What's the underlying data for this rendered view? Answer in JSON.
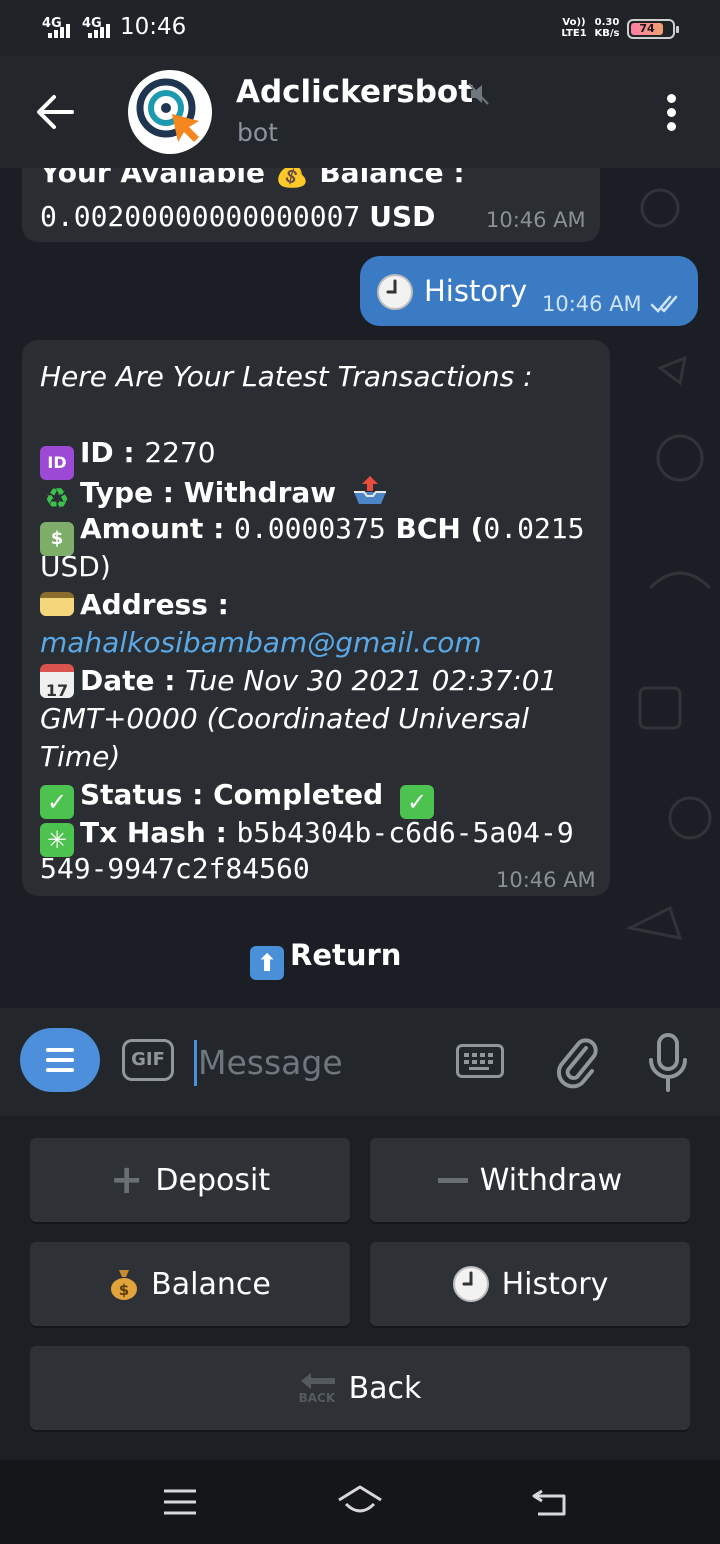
{
  "status_bar": {
    "net1": "4G",
    "net2": "4G",
    "time": "10:46",
    "volte": "Vo)) LTE1",
    "speed": "0.30 KB/s",
    "battery": "74"
  },
  "header": {
    "title": "Adclickersbot",
    "subtitle": "bot"
  },
  "messages": {
    "balance": {
      "label": "Your Available 💰 Balance :",
      "value": "0.00200000000000007",
      "unit": "USD",
      "time": "10:46 AM"
    },
    "history_out": {
      "text": "History",
      "time": "10:46 AM"
    },
    "transactions": {
      "heading": "Here Are Your Latest Transactions :",
      "id_label": "ID : ",
      "id_value": "2270",
      "type_label": "Type : Withdraw",
      "amount_label": "Amount : ",
      "amount_value": "0.0000375",
      "amount_currency": " BCH (",
      "amount_usd": "0.0215",
      "amount_usd_unit": "USD)",
      "address_label": "Address :",
      "address_value": "mahalkosibambam@gmail.com",
      "date_label": "Date : ",
      "date_value_1": "Tue Nov 30 2021 02:37:01",
      "date_value_2": "GMT+0000 (Coordinated Universal",
      "date_value_3": "Time)",
      "status_label": "Status : Completed",
      "hash_label": "Tx Hash : ",
      "hash_value_1": "b5b4304b-c6d6-5a04-9",
      "hash_value_2": "549-9947c2f84560",
      "time": "10:46 AM"
    },
    "return_label": "Return"
  },
  "input": {
    "gif": "GIF",
    "placeholder": "Message"
  },
  "keyboard": {
    "deposit": "Deposit",
    "withdraw": "Withdraw",
    "balance": "Balance",
    "history": "History",
    "back": "Back",
    "back_icon_text": "BACK"
  },
  "icons": {
    "back": "arrow-left-icon",
    "mute": "speaker-muted-icon",
    "menu": "more-vertical-icon",
    "clock": "clock-icon",
    "check": "double-check-icon",
    "keyboard": "keyboard-icon",
    "attach": "paperclip-icon",
    "mic": "microphone-icon"
  },
  "colors": {
    "accent": "#4d8fdb",
    "outgoing_bubble": "#3a7bc4",
    "incoming_bubble": "#2a2e33",
    "link": "#5aa9e6",
    "check_green": "#4cc34f"
  }
}
